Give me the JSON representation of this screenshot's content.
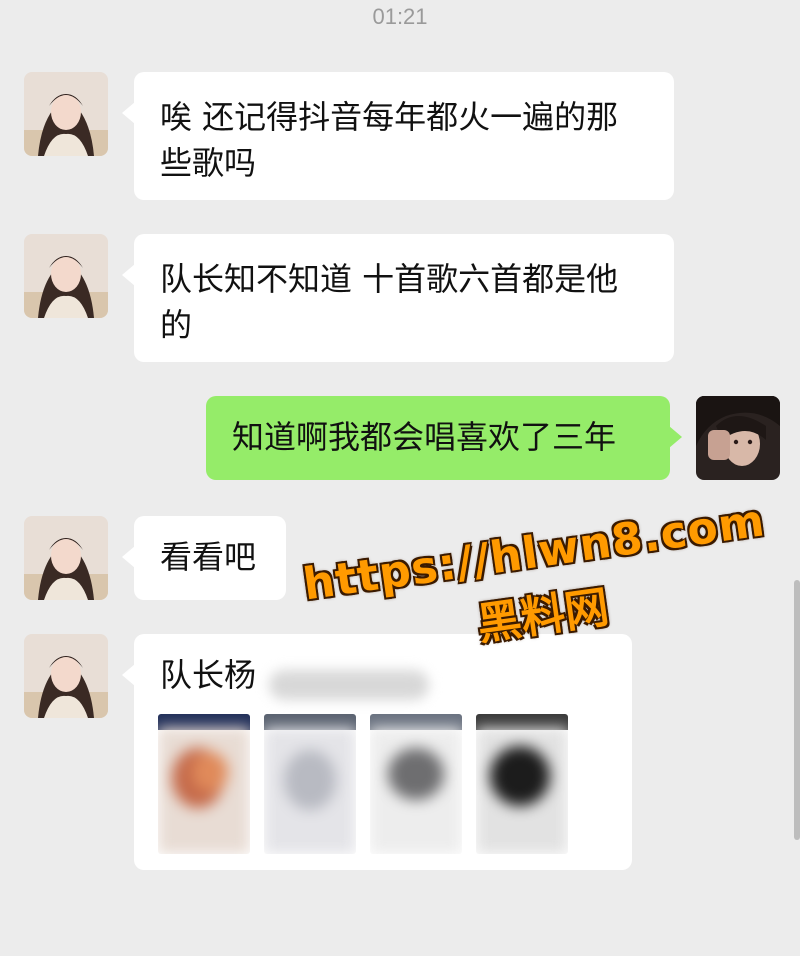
{
  "chat": {
    "timestamp": "01:21",
    "messages": [
      {
        "side": "left",
        "text_line1": "唉 还记得抖音每年都火一遍的那",
        "text_line2": "些歌吗"
      },
      {
        "side": "left",
        "text_line1": "队长知不知道 十首歌六首都是他",
        "text_line2": "的"
      },
      {
        "side": "right",
        "text": "知道啊我都会唱喜欢了三年"
      },
      {
        "side": "left",
        "text": "看看吧"
      },
      {
        "side": "left",
        "text": "队长杨"
      }
    ]
  },
  "watermark": {
    "url": "https://hlwn8.com",
    "name": "黑料网"
  },
  "colors": {
    "background": "#ececec",
    "incoming_bubble": "#ffffff",
    "outgoing_bubble": "#95ec69",
    "watermark": "#ff9a00"
  },
  "icons": {
    "contact_avatar": "contact-avatar-icon",
    "self_avatar": "self-avatar-icon"
  }
}
